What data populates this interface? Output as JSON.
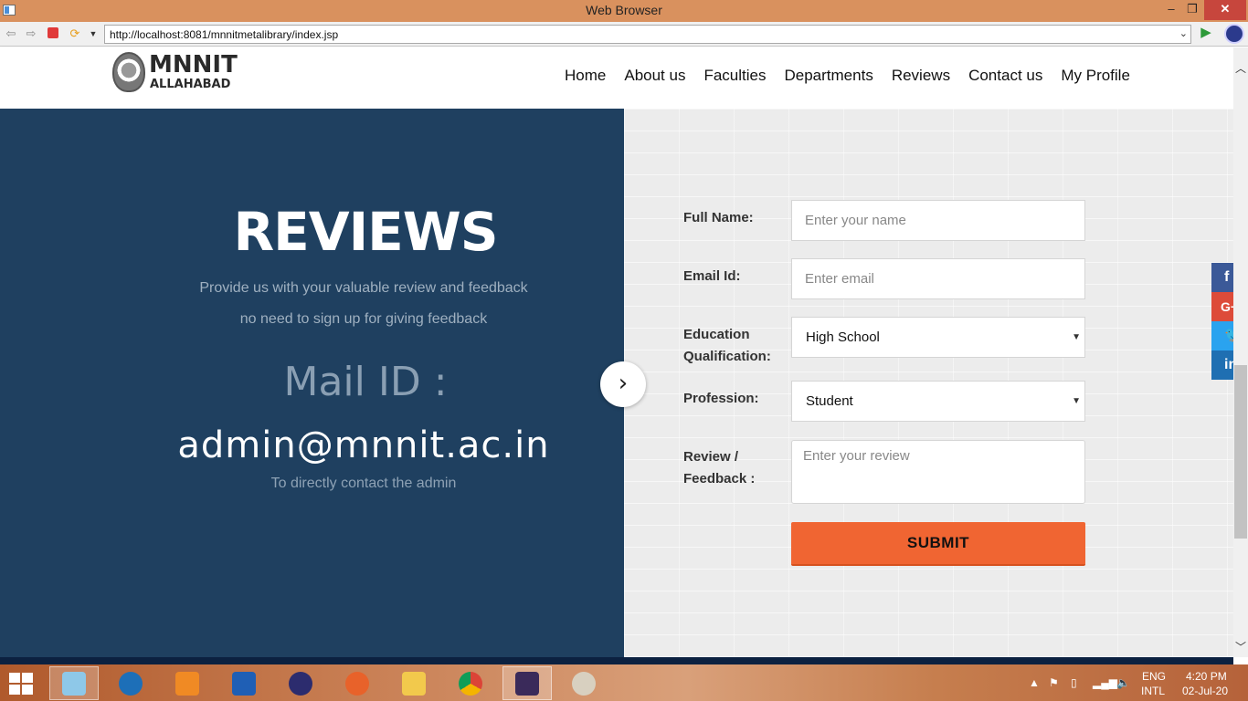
{
  "window": {
    "title": "Web Browser",
    "controls": {
      "minimize": "‒",
      "maximize": "❐",
      "close": "✕"
    }
  },
  "browser": {
    "url": "http://localhost:8081/mnnitmetalibrary/index.jsp",
    "icons": [
      "back-icon",
      "forward-icon",
      "stop-icon",
      "refresh-icon",
      "go-icon",
      "eclipse-icon"
    ]
  },
  "site": {
    "logo": {
      "title": "MNNIT",
      "subtitle": "ALLAHABAD"
    },
    "nav": [
      {
        "label": "Home"
      },
      {
        "label": "About us"
      },
      {
        "label": "Faculties"
      },
      {
        "label": "Departments"
      },
      {
        "label": "Reviews"
      },
      {
        "label": "Contact us"
      },
      {
        "label": "My Profile"
      }
    ]
  },
  "hero": {
    "title": "REVIEWS",
    "line1": "Provide us with your valuable review and feedback",
    "line2": "no need to sign up for giving feedback",
    "mail_label": "Mail ID :",
    "mail_address": "admin@mnnit.ac.in",
    "contact_note": "To directly contact the admin",
    "next_arrow": "›"
  },
  "form": {
    "full_name": {
      "label": "Full Name:",
      "placeholder": "Enter your name",
      "value": ""
    },
    "email": {
      "label": "Email Id:",
      "placeholder": "Enter email",
      "value": ""
    },
    "education": {
      "label_line1": "Education",
      "label_line2": "Qualification:",
      "selected": "High School"
    },
    "profession": {
      "label": "Profession:",
      "selected": "Student"
    },
    "review": {
      "label_line1": "Review /",
      "label_line2": "Feedback :",
      "placeholder": "Enter your review"
    },
    "submit_label": "SUBMIT"
  },
  "social": [
    {
      "name": "facebook-icon",
      "glyph": "f",
      "color": "#3b5998"
    },
    {
      "name": "google-plus-icon",
      "glyph": "G+",
      "color": "#dd4b39"
    },
    {
      "name": "twitter-icon",
      "glyph": "🐦",
      "color": "#2aa3ef"
    },
    {
      "name": "linkedin-icon",
      "glyph": "in",
      "color": "#1f6fb2"
    }
  ],
  "taskbar": {
    "language": "ENG",
    "layout": "INTL",
    "time": "4:20 PM",
    "date": "02-Jul-20"
  }
}
